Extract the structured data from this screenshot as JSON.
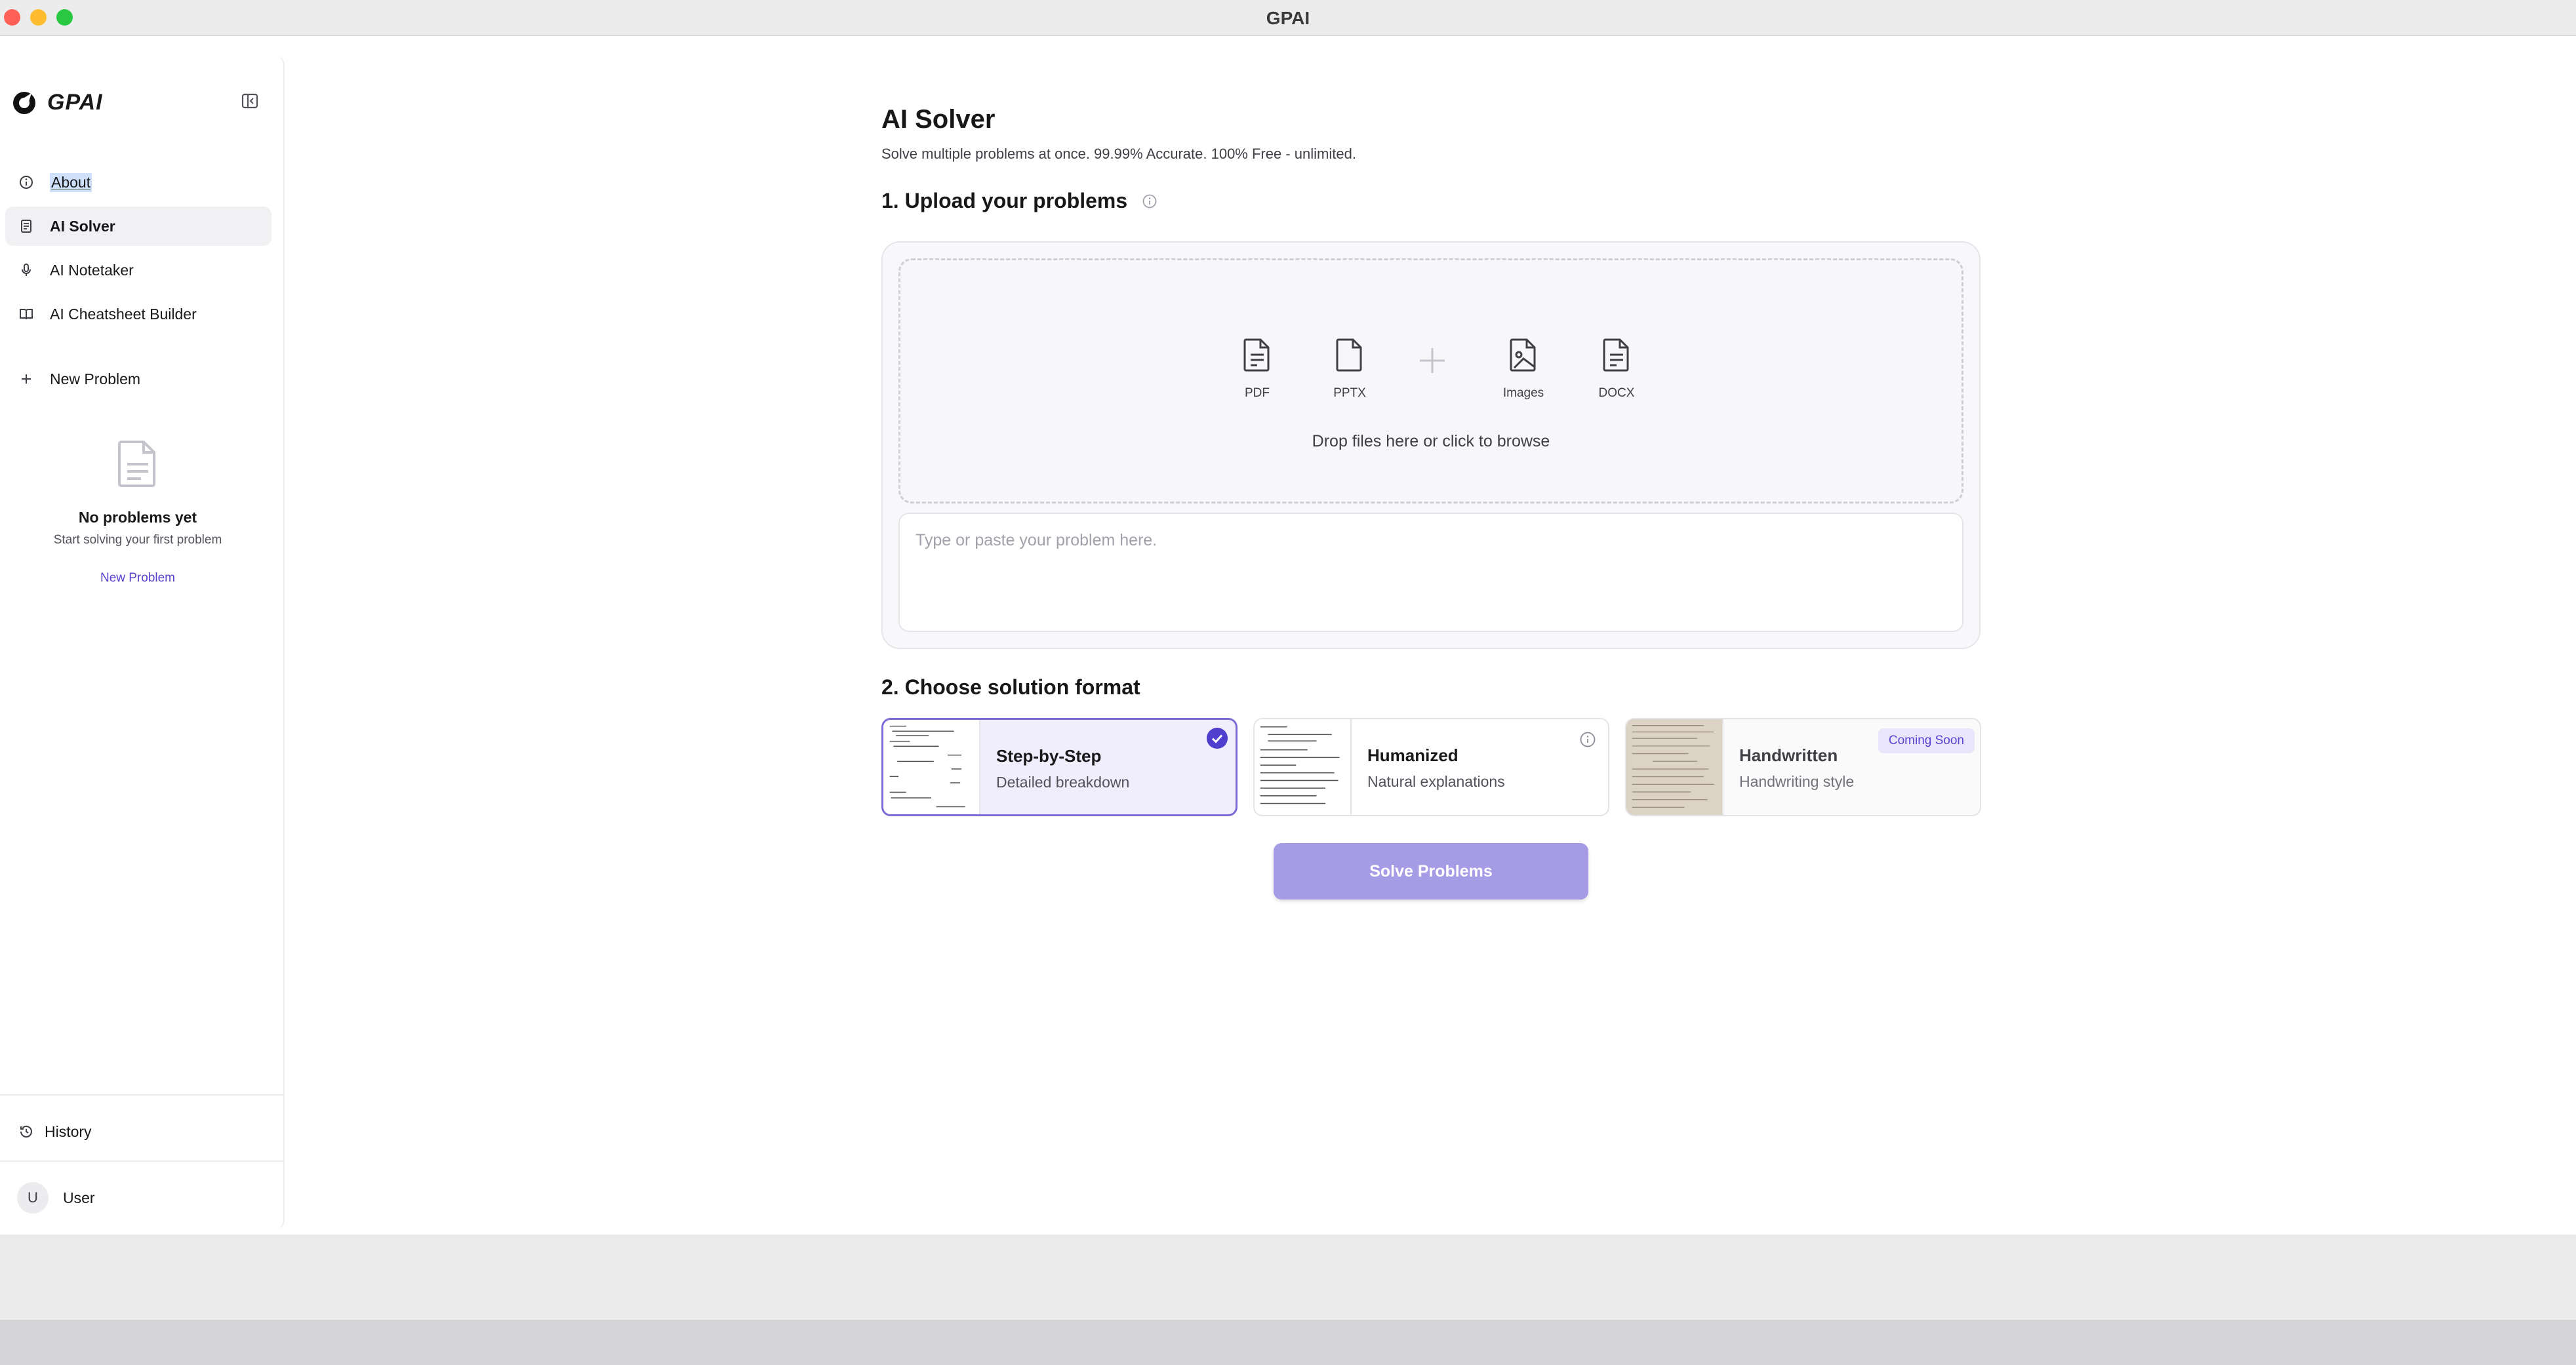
{
  "window": {
    "title": "GPAI"
  },
  "sidebar": {
    "brand": "GPAI",
    "items": [
      {
        "label": "About",
        "icon": "info-icon"
      },
      {
        "label": "AI Solver",
        "icon": "document-icon",
        "active": true
      },
      {
        "label": "AI Notetaker",
        "icon": "microphone-icon"
      },
      {
        "label": "AI Cheatsheet Builder",
        "icon": "book-icon"
      }
    ],
    "new_problem": "New Problem",
    "empty": {
      "title": "No problems yet",
      "subtitle": "Start solving your first problem",
      "link": "New Problem"
    },
    "history": "History",
    "user": {
      "initial": "U",
      "name": "User"
    }
  },
  "main": {
    "title": "AI Solver",
    "subtitle": "Solve multiple problems at once. 99.99% Accurate. 100% Free - unlimited.",
    "upload_heading": "1. Upload your problems",
    "file_types": [
      "PDF",
      "PPTX",
      "Images",
      "DOCX"
    ],
    "drop_text": "Drop files here or click to browse",
    "textarea_placeholder": "Type or paste your problem here.",
    "format_heading": "2. Choose solution format",
    "formats": [
      {
        "name": "Step-by-Step",
        "desc": "Detailed breakdown",
        "selected": true
      },
      {
        "name": "Humanized",
        "desc": "Natural explanations"
      },
      {
        "name": "Handwritten",
        "desc": "Handwriting style",
        "badge": "Coming Soon"
      }
    ],
    "solve_button": "Solve Problems"
  },
  "colors": {
    "accent": "#4f3fcf",
    "button_disabled": "#a69ce6",
    "link": "#5b3fd1"
  }
}
